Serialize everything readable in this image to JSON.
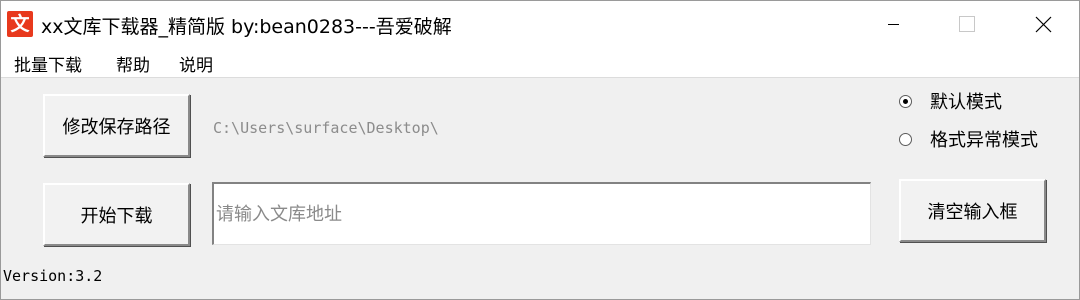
{
  "window": {
    "icon_glyph": "文",
    "icon_color": "#e8391d",
    "title": "xx文库下载器_精简版  by:bean0283---吾爱破解"
  },
  "menu": {
    "items": [
      {
        "label": "批量下载"
      },
      {
        "label": "帮助"
      },
      {
        "label": "说明"
      }
    ]
  },
  "main": {
    "save_path_button": "修改保存路径",
    "save_path_value": "C:\\Users\\surface\\Desktop\\",
    "start_button": "开始下载",
    "url_input": {
      "value": "",
      "placeholder": "请输入文库地址"
    },
    "clear_button": "清空输入框",
    "modes": [
      {
        "label": "默认模式",
        "selected": true
      },
      {
        "label": "格式异常模式",
        "selected": false
      }
    ]
  },
  "status": {
    "version": "Version:3.2"
  },
  "icons": {
    "minimize": "minimize-icon",
    "maximize": "maximize-icon",
    "close": "close-icon"
  }
}
